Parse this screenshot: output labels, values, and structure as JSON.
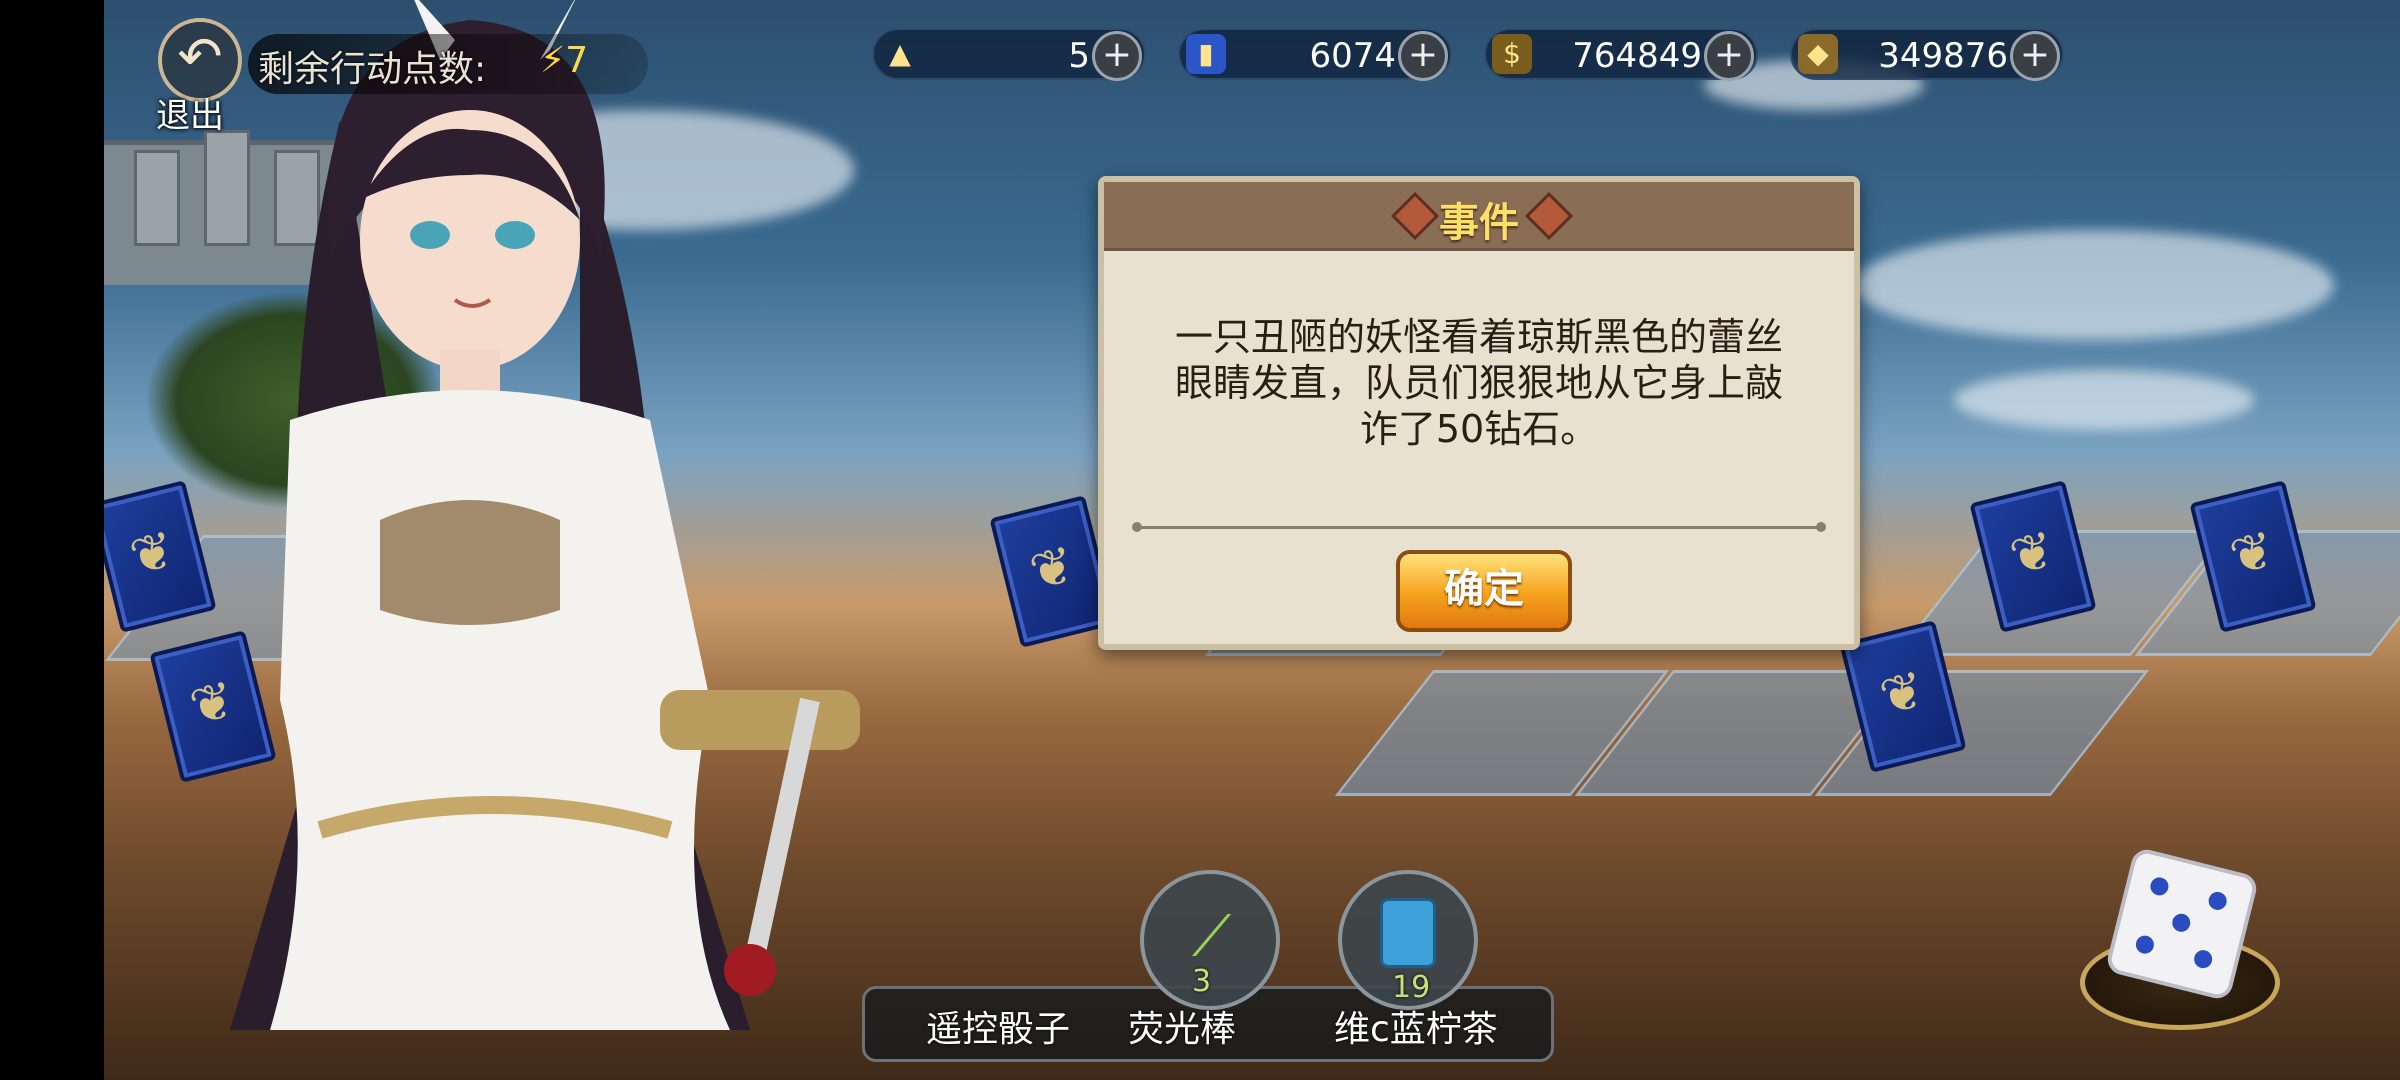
{
  "top_bar": {
    "exit_label": "退出",
    "action_points_label": "剩余行动点数:",
    "action_points_value": "7",
    "resources": [
      {
        "icon": "gold-ingot-icon",
        "value": "5"
      },
      {
        "icon": "blue-card-icon",
        "value": "6074"
      },
      {
        "icon": "coin-icon",
        "value": "764849"
      },
      {
        "icon": "gem-icon",
        "value": "349876"
      }
    ],
    "plus_symbol": "+"
  },
  "dialog": {
    "title": "事件",
    "message": "一只丑陋的妖怪看着琼斯黑色的蕾丝眼睛发直，队员们狠狠地从它身上敲诈了50钻石。",
    "confirm_label": "确定"
  },
  "items": [
    {
      "label": "遥控骰子",
      "icon": "remote-dice-icon",
      "count": ""
    },
    {
      "label": "荧光棒",
      "icon": "glowstick-icon",
      "count": "3"
    },
    {
      "label": "维c蓝柠茶",
      "icon": "blue-bottle-icon",
      "count": "19"
    }
  ],
  "colors": {
    "dialog_bg": "#e9e1cf",
    "dialog_header": "#8a6d55",
    "title_text": "#ffe067",
    "confirm_button": "#f5a21c"
  }
}
